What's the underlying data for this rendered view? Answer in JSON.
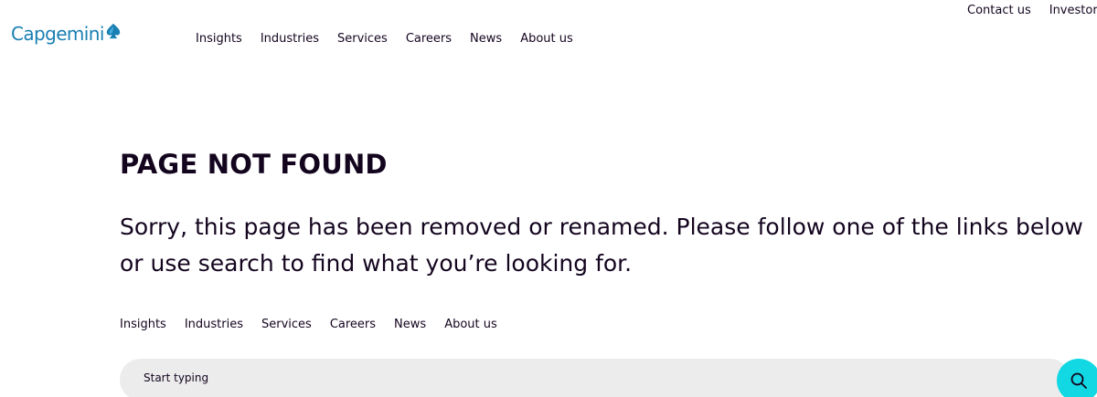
{
  "header": {
    "logo_text": "Capgemini",
    "utility_links": [
      "Contact us",
      "Investors"
    ],
    "nav_items": [
      "Insights",
      "Industries",
      "Services",
      "Careers",
      "News",
      "About us"
    ]
  },
  "main": {
    "title": "PAGE NOT FOUND",
    "message": "Sorry, this page has been removed or renamed. Please follow one of the links below or use search to find what you’re looking for.",
    "links": [
      "Insights",
      "Industries",
      "Services",
      "Careers",
      "News",
      "About us"
    ],
    "search": {
      "placeholder": "Start typing"
    }
  },
  "icons": {
    "logo_mark": "spade-icon",
    "search": "search-icon"
  },
  "colors": {
    "brand_blue": "#1a7fb3",
    "accent_cyan": "#12d8e3",
    "text_dark": "#14051f",
    "search_bg": "#ececec"
  }
}
